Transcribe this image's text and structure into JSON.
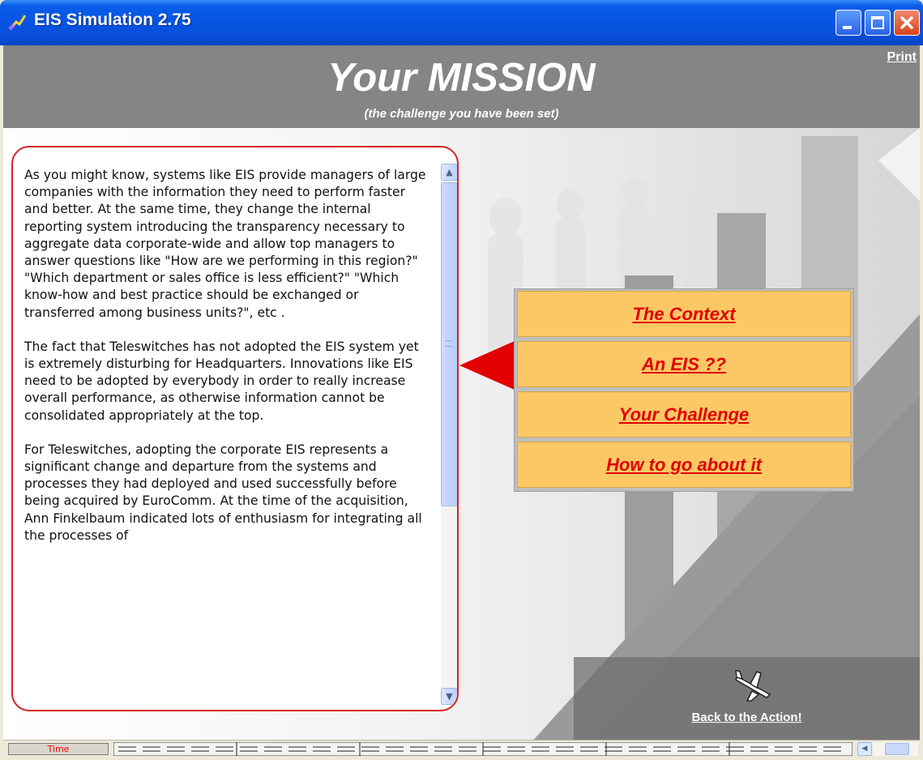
{
  "window": {
    "title": "EIS Simulation 2.75",
    "controls": [
      "minimize-icon",
      "maximize-icon",
      "close-icon"
    ]
  },
  "header": {
    "title": "Your MISSION",
    "subtitle": "(the challenge you have been set)",
    "print_label": "Print"
  },
  "text_panel": {
    "paragraphs": [
      "As you might know, systems like EIS provide managers of large companies with the information they need to perform faster and better. At the same time, they change the internal reporting system introducing the transparency necessary to aggregate data corporate-wide and allow top managers to answer questions like \"How are we performing in this region?\" \"Which department or sales office is less efficient?\" \"Which know-how and best practice should be exchanged or transferred among business units?\", etc .",
      "The fact that Teleswitches has not adopted the EIS system yet is extremely disturbing for Headquarters. Innovations like EIS need to be adopted by everybody in order to really increase overall performance, as otherwise information cannot be consolidated appropriately at the top.",
      "For Teleswitches, adopting the corporate EIS represents a significant change and departure from the systems and processes they had deployed and used successfully before being acquired by EuroComm. At the time of the acquisition, Ann Finkelbaum indicated lots of enthusiasm for integrating all the processes of"
    ]
  },
  "menu": {
    "items": [
      {
        "label": "The Context"
      },
      {
        "label": "An EIS ??"
      },
      {
        "label": "Your Challenge"
      },
      {
        "label": "How to go about it"
      }
    ],
    "selected_index": 1
  },
  "action": {
    "back_label": "Back to the Action!",
    "icon": "airplane-icon"
  },
  "status": {
    "time_label": "Time"
  },
  "colors": {
    "title_bar": "#0654e3",
    "header_band": "#858585",
    "panel_border": "#d62323",
    "menu_fill": "#fcc865",
    "menu_text": "#e00000",
    "time_text": "#ff0000"
  }
}
